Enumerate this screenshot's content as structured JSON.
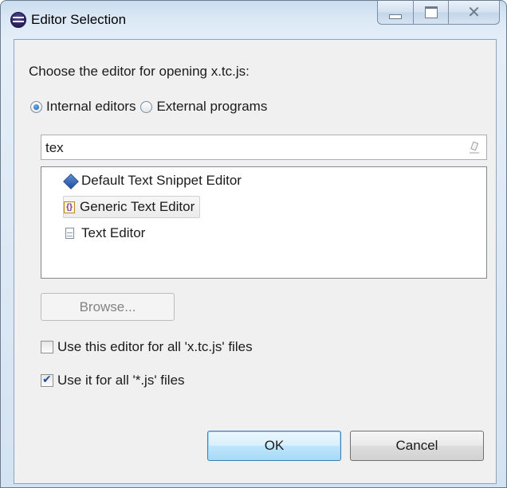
{
  "window": {
    "title": "Editor Selection"
  },
  "dialog": {
    "prompt": "Choose the editor for opening x.tc.js:",
    "radio_internal": "Internal editors",
    "radio_external": "External programs",
    "selected_radio": "Internal editors",
    "filter_value": "tex",
    "editors": [
      {
        "label": "Default Text Snippet Editor",
        "icon": "text-snippet-editor-icon"
      },
      {
        "label": "Generic Text Editor",
        "icon": "generic-editor-icon",
        "selected": true
      },
      {
        "label": "Text Editor",
        "icon": "text-file-icon"
      }
    ],
    "browse_label": "Browse...",
    "check_this_editor": "Use this editor for all 'x.tc.js' files",
    "check_this_editor_checked": false,
    "check_all_js": "Use it for all '*.js' files",
    "check_all_js_checked": true,
    "ok_label": "OK",
    "cancel_label": "Cancel"
  },
  "colors": {
    "ok_border": "#3c7fb1",
    "selection_bg": "#ebebeb"
  }
}
